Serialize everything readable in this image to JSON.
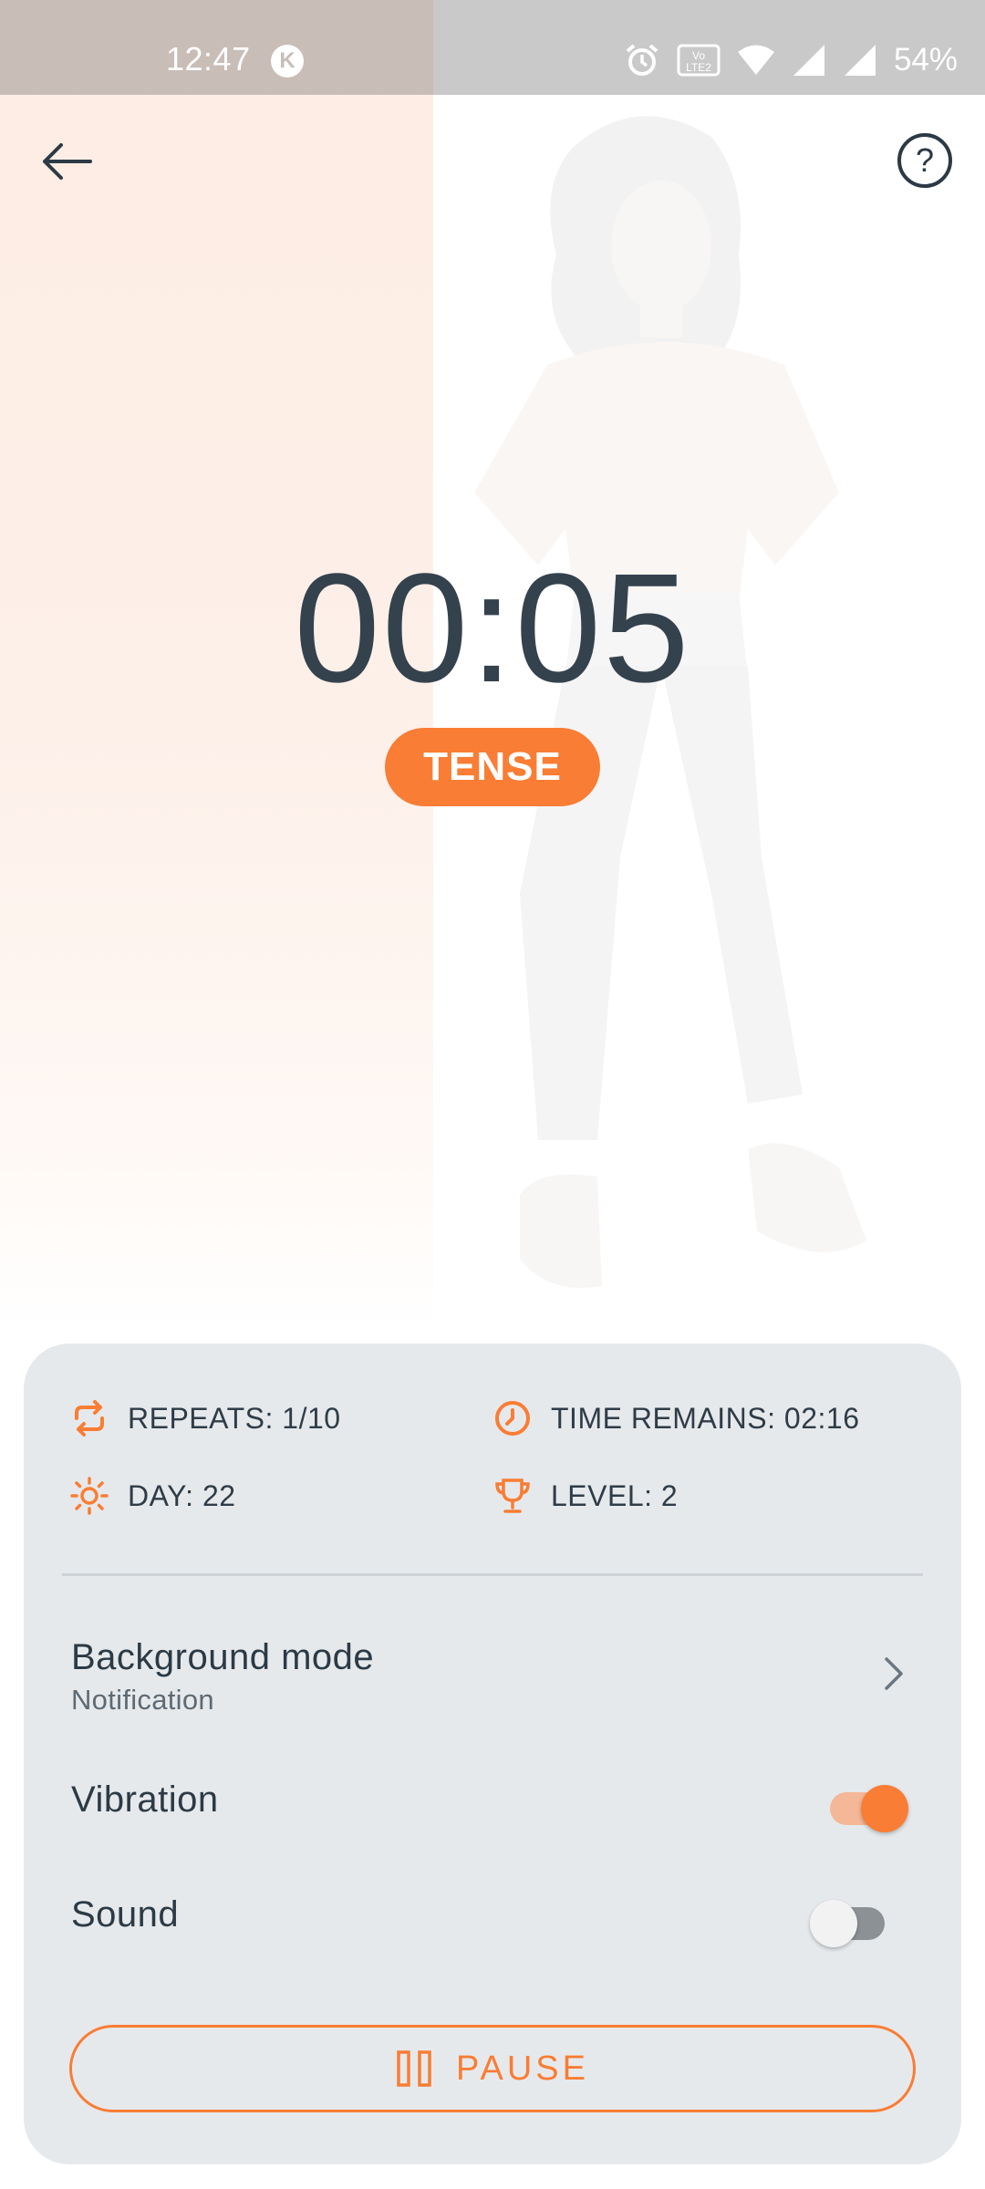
{
  "status_bar": {
    "time": "12:47",
    "notification_icon": "K",
    "battery": "54%",
    "icons": [
      "alarm-icon",
      "volte-icon",
      "wifi-icon",
      "signal-icon",
      "signal-icon",
      "battery-text"
    ]
  },
  "header": {
    "back_icon": "arrow-left-icon",
    "help_icon": "?"
  },
  "timer": {
    "value": "00:05",
    "phase": "TENSE",
    "progress_fraction": 0.44
  },
  "stats": {
    "repeats_label": "REPEATS: 1/10",
    "time_remains_label": "TIME REMAINS: 02:16",
    "day_label": "DAY: 22",
    "level_label": "LEVEL: 2"
  },
  "settings": {
    "background_mode": {
      "title": "Background mode",
      "value": "Notification"
    },
    "vibration": {
      "title": "Vibration",
      "enabled": true
    },
    "sound": {
      "title": "Sound",
      "enabled": false
    }
  },
  "actions": {
    "pause_label": "PAUSE"
  },
  "colors": {
    "accent": "#f97d34",
    "text_dark": "#2c3a45",
    "panel_bg": "#e6e9ec",
    "progress_tint": "#fdece3"
  }
}
